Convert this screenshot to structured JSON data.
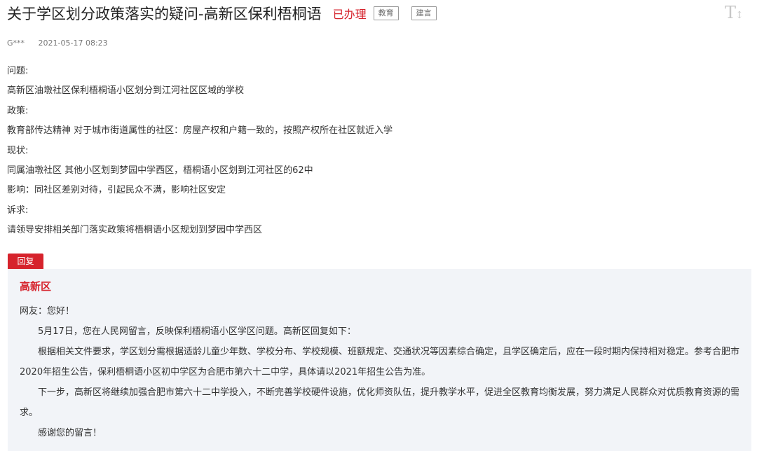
{
  "header": {
    "title": "关于学区划分政策落实的疑问-高新区保利梧桐语",
    "status": "已办理",
    "tags": [
      "教育",
      "建言"
    ],
    "font_size_icon": "font-size-icon"
  },
  "meta": {
    "user": "G***",
    "time": "2021-05-17 08:23"
  },
  "content": {
    "lines": [
      "问题:",
      "高新区油墩社区保利梧桐语小区划分到江河社区区域的学校",
      "政策:",
      "教育部传达精神 对于城市街道属性的社区：房屋产权和户籍一致的，按照产权所在社区就近入学",
      "现状:",
      "同属油墩社区 其他小区划到梦园中学西区，梧桐语小区划到江河社区的62中",
      "影响：同社区差别对待，引起民众不满，影响社区安定",
      "诉求:",
      "请领导安排相关部门落实政策将梧桐语小区规划到梦园中学西区"
    ]
  },
  "reply": {
    "label": "回复",
    "department": "高新区",
    "greeting": "网友：您好！",
    "paragraphs": [
      "5月17日，您在人民网留言，反映保利梧桐语小区学区问题。高新区回复如下：",
      "根据相关文件要求，学区划分需根据适龄儿童少年数、学校分布、学校规模、班额规定、交通状况等因素综合确定，且学区确定后，应在一段时期内保持相对稳定。参考合肥市2020年招生公告，保利梧桐语小区初中学区为合肥市第六十二中学，具体请以2021年招生公告为准。",
      "下一步，高新区将继续加强合肥市第六十二中学投入，不断完善学校硬件设施，优化师资队伍，提升教学水平，促进全区教育均衡发展，努力满足人民群众对优质教育资源的需求。",
      "感谢您的留言！"
    ]
  },
  "colors": {
    "accent": "#d6232c",
    "reply_background": "#f2f4f8"
  }
}
